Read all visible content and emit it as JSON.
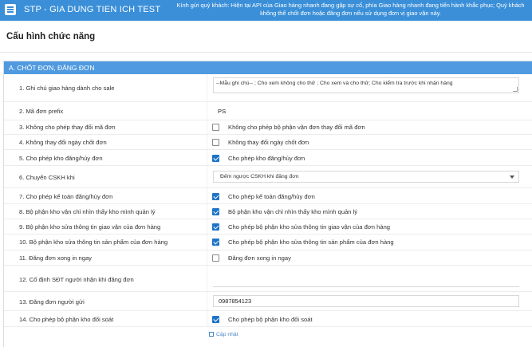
{
  "header": {
    "app_title": "STP - GIA DUNG TIEN ICH TEST",
    "notice_line1": "Kính gửi quý khách: Hiện tại API của Giao hàng nhanh đang gặp sự cố, phía Giao hàng nhanh đang tiến hành khắc phục; Quý khách",
    "notice_line2": "không thể chốt đơn hoặc đăng đơn nếu sử dụng đơn vị giao vận này."
  },
  "page": {
    "title": "Cấu hình chức năng"
  },
  "section": {
    "title": "A. CHỐT ĐƠN, ĐĂNG ĐƠN"
  },
  "rows": [
    {
      "label": "1. Ghi chú giao hàng dành cho sale",
      "type": "textarea",
      "value": "--Mẫu ghi chú-- ; Cho xem không cho thử ; Cho xem và cho thử; Cho kiểm tra trước khi nhận hàng"
    },
    {
      "label": "2. Mã đơn prefix",
      "type": "text",
      "value": "PS"
    },
    {
      "label": "3. Không cho phép thay đổi mã đơn",
      "type": "checkbox",
      "checked": false,
      "option": "Không cho phép bộ phận vận đơn thay đổi mã đơn"
    },
    {
      "label": "4. Không thay đổi ngày chốt đơn",
      "type": "checkbox",
      "checked": false,
      "option": "Không thay đổi ngày chốt đơn"
    },
    {
      "label": "5. Cho phép kho đăng/hủy đơn",
      "type": "checkbox",
      "checked": true,
      "option": "Cho phép kho đăng/hủy đơn"
    },
    {
      "label": "6. Chuyển CSKH khi",
      "type": "select",
      "value": "Đếm ngược CSKH khi đăng đơn"
    },
    {
      "label": "7. Cho phép kế toán đăng/hủy đơn",
      "type": "checkbox",
      "checked": true,
      "option": "Cho phép kế toán đăng/hủy đơn"
    },
    {
      "label": "8. Bộ phận kho vận chỉ nhìn thấy kho mình quản lý",
      "type": "checkbox",
      "checked": true,
      "option": "Bộ phận kho vận chỉ nhìn thấy kho mình quản lý"
    },
    {
      "label": "9. Bộ phận kho sửa thông tin giao vận của đơn hàng",
      "type": "checkbox",
      "checked": true,
      "option": "Cho phép bộ phận kho sửa thông tin giao vận của đơn hàng"
    },
    {
      "label": "10. Bộ phận kho sửa thông tin sản phẩm của đơn hàng",
      "type": "checkbox",
      "checked": true,
      "option": "Cho phép bộ phận kho sửa thông tin sản phẩm của đơn hàng"
    },
    {
      "label": "11. Đăng đơn xong in ngay",
      "type": "checkbox",
      "checked": false,
      "option": "Đăng đơn xong in ngay"
    },
    {
      "label": "12. Cố định SĐT người nhận khi đăng đơn",
      "type": "text",
      "value": ""
    },
    {
      "label": "13. Đăng đơn người gửi",
      "type": "text",
      "value": "0987854123"
    },
    {
      "label": "14. Cho phép bộ phận kho đối soát",
      "type": "checkbox",
      "checked": true,
      "option": "Cho phép bộ phận kho đối soát"
    }
  ],
  "actions": {
    "update_label": "Cập nhật"
  },
  "colors": {
    "topbar": "#3a8fd8",
    "section_header": "#4f9ae0",
    "checkbox_checked": "#1e74c9",
    "link": "#4a86c5"
  },
  "icons": {
    "menu": "hamburger-icon",
    "dropdown": "chevron-down-icon",
    "save": "save-icon"
  }
}
